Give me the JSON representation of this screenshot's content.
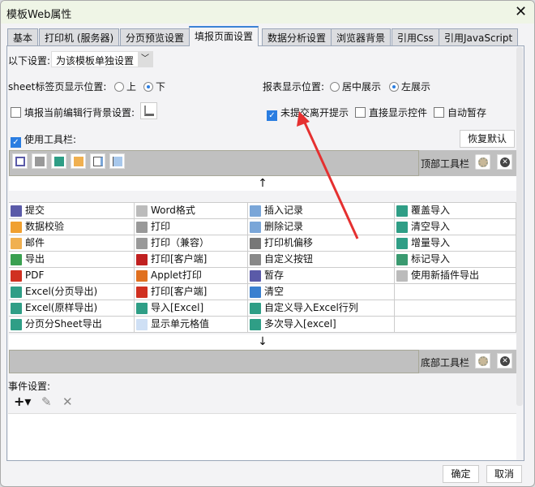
{
  "window": {
    "title": "模板Web属性",
    "close": "✕"
  },
  "tabs": [
    "基本",
    "打印机 (服务器)",
    "分页预览设置",
    "填报页面设置",
    "数据分析设置",
    "浏览器背景",
    "引用Css",
    "引用JavaScript"
  ],
  "active_tab": "填报页面设置",
  "settings": {
    "scope_label": "以下设置:",
    "scope_value": "为该模板单独设置",
    "sheet_pos_label": "sheet标签页显示位置:",
    "sheet_pos_options": [
      "上",
      "下"
    ],
    "sheet_pos_selected": "下",
    "report_pos_label": "报表显示位置:",
    "report_pos_options": [
      "居中展示",
      "左展示"
    ],
    "report_pos_selected": "左展示",
    "row_bg_label": "填报当前编辑行背景设置:",
    "row_bg_checked": false,
    "unsubmitted_label": "未提交离开提示",
    "unsubmitted_checked": true,
    "direct_widget_label": "直接显示控件",
    "direct_widget_checked": false,
    "autosave_label": "自动暂存",
    "autosave_checked": false,
    "use_toolbar_label": "使用工具栏:",
    "use_toolbar_checked": true,
    "restore_default": "恢复默认"
  },
  "top_toolbar": {
    "label": "顶部工具栏",
    "icons": [
      "save-icon",
      "print-icon",
      "excel-icon",
      "email-icon",
      "insert-row-icon",
      "delete-row-icon"
    ]
  },
  "bottom_toolbar": {
    "label": "底部工具栏"
  },
  "arrows": {
    "up": "↑",
    "down": "↓"
  },
  "buttons_grid": [
    [
      {
        "label": "提交",
        "icon": "save-icon",
        "color": "#5a5aa8"
      },
      {
        "label": "Word格式",
        "icon": "word-icon",
        "color": "#bbbbbb"
      },
      {
        "label": "插入记录",
        "icon": "insert-row-icon",
        "color": "#7aa6d8"
      },
      {
        "label": "覆盖导入",
        "icon": "excel-icon",
        "color": "#2f9e86"
      }
    ],
    [
      {
        "label": "数据校验",
        "icon": "pencil-icon",
        "color": "#f0a030"
      },
      {
        "label": "打印",
        "icon": "print-icon",
        "color": "#999999"
      },
      {
        "label": "删除记录",
        "icon": "delete-row-icon",
        "color": "#7aa6d8"
      },
      {
        "label": "清空导入",
        "icon": "excel-icon",
        "color": "#2f9e86"
      }
    ],
    [
      {
        "label": "邮件",
        "icon": "email-icon",
        "color": "#f0b050"
      },
      {
        "label": "打印（兼容）",
        "icon": "print-icon",
        "color": "#999999"
      },
      {
        "label": "打印机偏移",
        "icon": "move-icon",
        "color": "#777777"
      },
      {
        "label": "增量导入",
        "icon": "excel-icon",
        "color": "#2f9e86"
      }
    ],
    [
      {
        "label": "导出",
        "icon": "export-icon",
        "color": "#3aa050"
      },
      {
        "label": "打印[客户端]",
        "icon": "flash-print-icon",
        "color": "#c02020"
      },
      {
        "label": "自定义按钮",
        "icon": "gear-icon",
        "color": "#888888"
      },
      {
        "label": "标记导入",
        "icon": "excel-mark-icon",
        "color": "#3a9a70"
      }
    ],
    [
      {
        "label": "PDF",
        "icon": "pdf-icon",
        "color": "#d03020"
      },
      {
        "label": "Applet打印",
        "icon": "java-icon",
        "color": "#e07020"
      },
      {
        "label": "暂存",
        "icon": "temp-save-icon",
        "color": "#5a5aa8"
      },
      {
        "label": "使用新插件导出",
        "icon": "word-icon",
        "color": "#bbbbbb"
      }
    ],
    [
      {
        "label": "Excel(分页导出)",
        "icon": "excel-icon",
        "color": "#2f9e86"
      },
      {
        "label": "打印[客户端]",
        "icon": "pdf-print-icon",
        "color": "#d03020"
      },
      {
        "label": "清空",
        "icon": "eraser-icon",
        "color": "#3a80d0"
      },
      {
        "label": "",
        "icon": "",
        "color": ""
      }
    ],
    [
      {
        "label": "Excel(原样导出)",
        "icon": "excel-icon",
        "color": "#2f9e86"
      },
      {
        "label": "导入[Excel]",
        "icon": "excel-icon",
        "color": "#2f9e86"
      },
      {
        "label": "自定义导入Excel行列",
        "icon": "excel-icon",
        "color": "#2f9e86"
      },
      {
        "label": "",
        "icon": "",
        "color": ""
      }
    ],
    [
      {
        "label": "分页分Sheet导出",
        "icon": "excel-icon",
        "color": "#2f9e86"
      },
      {
        "label": "显示单元格值",
        "icon": "cell-icon",
        "color": "#cfe0f5"
      },
      {
        "label": "多次导入[excel]",
        "icon": "excel-icon",
        "color": "#2f9e86"
      },
      {
        "label": "",
        "icon": "",
        "color": ""
      }
    ]
  ],
  "events": {
    "label": "事件设置:",
    "add": "+▾",
    "edit": "✎",
    "delete": "✕"
  },
  "footer": {
    "ok": "确定",
    "cancel": "取消"
  },
  "colors": {
    "accent": "#2a7de1",
    "annotation": "#e53030"
  }
}
